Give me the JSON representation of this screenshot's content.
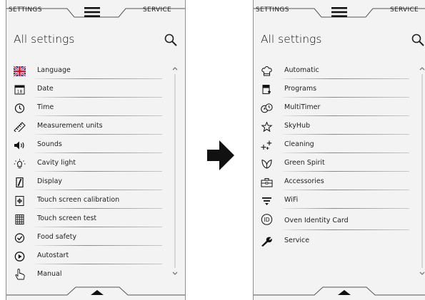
{
  "left_panel": {
    "top_left_label": "SETTINGS",
    "top_right_label": "SERVICE",
    "title": "All settings",
    "items": [
      {
        "label": "Language",
        "icon": "uk-flag-icon"
      },
      {
        "label": "Date",
        "icon": "calendar-icon"
      },
      {
        "label": "Time",
        "icon": "clock-icon"
      },
      {
        "label": "Measurement units",
        "icon": "ruler-icon"
      },
      {
        "label": "Sounds",
        "icon": "speaker-icon"
      },
      {
        "label": "Cavity light",
        "icon": "lightbulb-icon"
      },
      {
        "label": "Display",
        "icon": "display-icon"
      },
      {
        "label": "Touch screen calibration",
        "icon": "calibration-icon"
      },
      {
        "label": "Touch screen test",
        "icon": "grid-icon"
      },
      {
        "label": "Food safety",
        "icon": "check-circle-icon"
      },
      {
        "label": "Autostart",
        "icon": "play-circle-icon"
      },
      {
        "label": "Manual",
        "icon": "hand-pointer-icon"
      }
    ]
  },
  "right_panel": {
    "top_left_label": "SETTINGS",
    "top_right_label": "SERVICE",
    "title": "All settings",
    "items": [
      {
        "label": "Automatic",
        "icon": "chef-hat-icon"
      },
      {
        "label": "Programs",
        "icon": "programs-icon"
      },
      {
        "label": "MultiTimer",
        "icon": "multitimer-icon"
      },
      {
        "label": "SkyHub",
        "icon": "star-icon"
      },
      {
        "label": "Cleaning",
        "icon": "sparkle-icon"
      },
      {
        "label": "Green Spirit",
        "icon": "leaf-icon"
      },
      {
        "label": "Accessories",
        "icon": "toolbox-icon"
      },
      {
        "label": "WiFi",
        "icon": "wifi-icon"
      },
      {
        "label": "Oven Identity Card",
        "icon": "id-icon"
      },
      {
        "label": "Service",
        "icon": "wrench-icon"
      }
    ]
  },
  "transition_arrow": "right-arrow-icon",
  "colors": {
    "panel_background": "#f3f3f3",
    "text": "#222222",
    "border": "#8f8f8f"
  }
}
